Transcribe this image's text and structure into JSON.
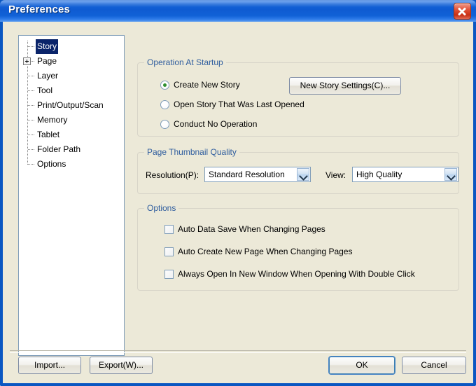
{
  "window": {
    "title": "Preferences",
    "close_icon": "close-icon",
    "titlebar_color": "#0f5bd2",
    "border_color": "#0a57c2",
    "face_color": "#ece9d8"
  },
  "tree": {
    "items": [
      {
        "label": "Story",
        "selected": true,
        "expandable": false
      },
      {
        "label": "Page",
        "selected": false,
        "expandable": true
      },
      {
        "label": "Layer",
        "selected": false,
        "expandable": false
      },
      {
        "label": "Tool",
        "selected": false,
        "expandable": false
      },
      {
        "label": "Print/Output/Scan",
        "selected": false,
        "expandable": false
      },
      {
        "label": "Memory",
        "selected": false,
        "expandable": false
      },
      {
        "label": "Tablet",
        "selected": false,
        "expandable": false
      },
      {
        "label": "Folder Path",
        "selected": false,
        "expandable": false
      },
      {
        "label": "Options",
        "selected": false,
        "expandable": false
      }
    ],
    "selection_color": "#0a246a"
  },
  "startup_group": {
    "title": "Operation At Startup",
    "radios": [
      {
        "label": "Create New Story",
        "checked": true
      },
      {
        "label": "Open Story That Was Last Opened",
        "checked": false
      },
      {
        "label": "Conduct No Operation",
        "checked": false
      }
    ],
    "settings_button": "New Story Settings(C)...",
    "radio_dot_color": "#2f8f2f"
  },
  "thumbnail_group": {
    "title": "Page Thumbnail Quality",
    "resolution_label": "Resolution(P):",
    "resolution_value": "Standard Resolution",
    "view_label": "View:",
    "view_value": "High Quality",
    "dropdown_icon": "chevron-down-icon"
  },
  "options_group": {
    "title": "Options",
    "checkboxes": [
      {
        "label": "Auto Data Save When Changing Pages",
        "checked": false
      },
      {
        "label": "Auto Create New Page When Changing Pages",
        "checked": false
      },
      {
        "label": "Always Open In New Window When Opening With Double Click",
        "checked": false
      }
    ]
  },
  "footer": {
    "import_label": "Import...",
    "export_label": "Export(W)...",
    "ok_label": "OK",
    "cancel_label": "Cancel",
    "default_button": "OK"
  }
}
